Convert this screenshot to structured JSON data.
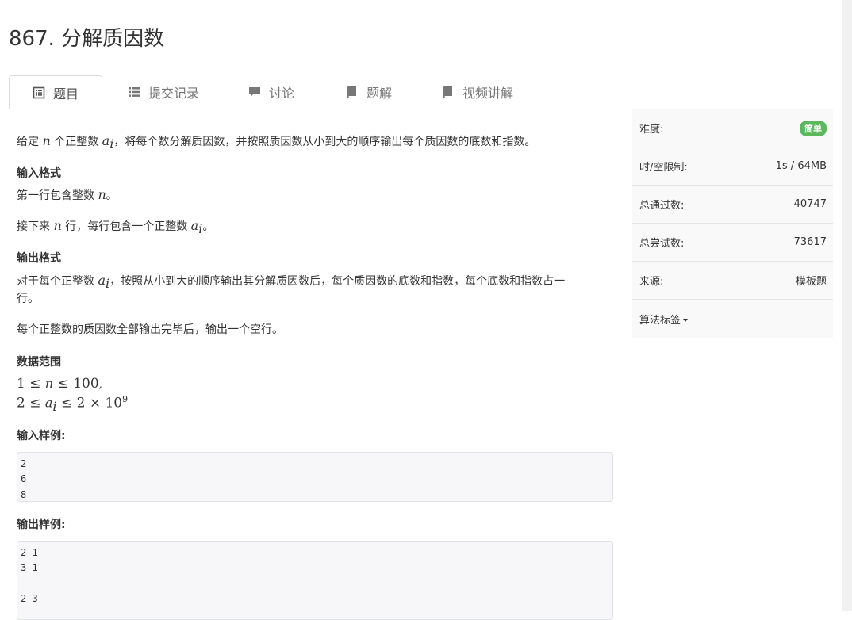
{
  "problem": {
    "title": "867. 分解质因数"
  },
  "tabs": [
    {
      "label": "题目",
      "icon": "list-alt-icon",
      "active": true
    },
    {
      "label": "提交记录",
      "icon": "list-icon"
    },
    {
      "label": "讨论",
      "icon": "comment-icon"
    },
    {
      "label": "题解",
      "icon": "book-icon"
    },
    {
      "label": "视频讲解",
      "icon": "book-icon"
    }
  ],
  "description": {
    "intro_pre": "给定",
    "intro_mid": "个正整数",
    "intro_post": "，将每个数分解质因数，并按照质因数从小到大的顺序输出每个质因数的底数和指数。",
    "var_n": "n",
    "var_a": "a",
    "var_i": "i"
  },
  "input_format": {
    "heading": "输入格式",
    "line1_pre": "第一行包含整数",
    "line1_post": "。",
    "line2_pre": "接下来",
    "line2_mid": "行，每行包含一个正整数",
    "line2_post": "。"
  },
  "output_format": {
    "heading": "输出格式",
    "line1_pre": "对于每个正整数",
    "line1_post": "，按照从小到大的顺序输出其分解质因数后，每个质因数的底数和指数，每个底数和指数占一",
    "line1_cont": "行。",
    "line2": "每个正整数的质因数全部输出完毕后，输出一个空行。"
  },
  "data_range": {
    "heading": "数据范围",
    "line1_left": "1 ≤ ",
    "line1_mid": " ≤ 100",
    "line1_end": ",",
    "line2_left": "2 ≤ ",
    "line2_mid": " ≤ 2 × 10",
    "line2_exp": "9"
  },
  "sample_input": {
    "heading": "输入样例:",
    "lines": [
      "2",
      "6",
      "8"
    ]
  },
  "sample_output": {
    "heading": "输出样例:",
    "lines": [
      "2 1",
      "3 1",
      "",
      "2 3"
    ]
  },
  "sidebar": {
    "difficulty_label": "难度:",
    "difficulty_value": "简单",
    "limit_label": "时/空限制:",
    "limit_value": "1s / 64MB",
    "accepted_label": "总通过数:",
    "accepted_value": "40747",
    "attempts_label": "总尝试数:",
    "attempts_value": "73617",
    "source_label": "来源:",
    "source_value": "模板题",
    "tags_label": "算法标签"
  },
  "colors": {
    "badge_green": "#5cb85c",
    "tab_border": "#dddddd",
    "code_bg": "#f7f7f9"
  }
}
